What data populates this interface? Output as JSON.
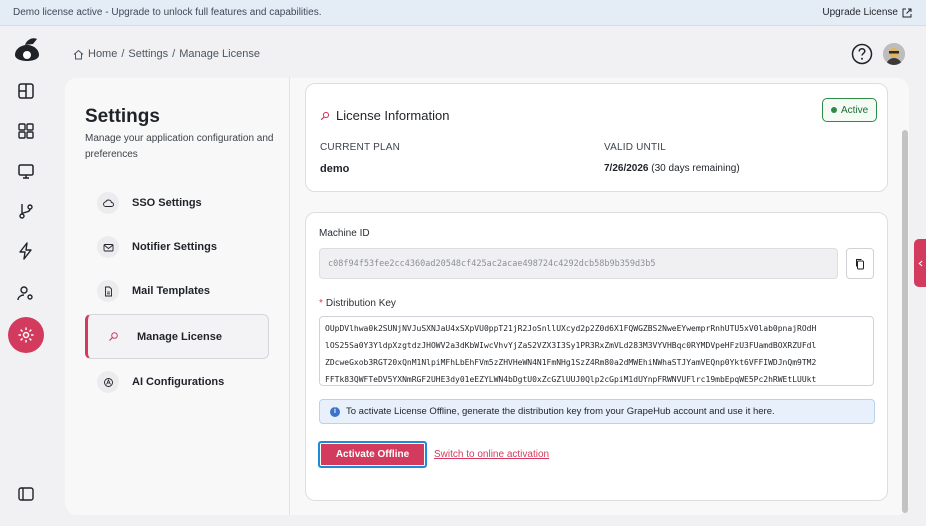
{
  "banner": {
    "message": "Demo license active - Upgrade to unlock full features and capabilities.",
    "upgrade_label": "Upgrade License"
  },
  "breadcrumb": {
    "home": "Home",
    "sep1": "/",
    "settings": "Settings",
    "sep2": "/",
    "current": "Manage License"
  },
  "settings": {
    "title": "Settings",
    "subtitle": "Manage your application configuration and preferences",
    "menu": [
      {
        "label": "SSO Settings",
        "icon": "cloud-key-icon"
      },
      {
        "label": "Notifier Settings",
        "icon": "mail-icon"
      },
      {
        "label": "Mail Templates",
        "icon": "document-icon"
      },
      {
        "label": "Manage License",
        "icon": "key-search-icon",
        "active": true
      },
      {
        "label": "AI Configurations",
        "icon": "ai-icon"
      }
    ]
  },
  "license": {
    "title": "License Information",
    "status": "Active",
    "plan_label": "CURRENT PLAN",
    "plan_value": "demo",
    "valid_label": "VALID UNTIL",
    "valid_date": "7/26/2026",
    "valid_remaining": " (30 days remaining)"
  },
  "activation": {
    "machine_id_label": "Machine ID",
    "machine_id": "c08f94f53fee2cc4360ad20548cf425ac2acae498724c4292dcb58b9b359d3b5",
    "dist_key_label": "Distribution Key",
    "dist_key_lines": [
      "OUpDVlhwa0k2SUNjNVJuSXNJaU4xSXpVU0ppT21jR2JoSnllUXcyd2p2Z0d6X1FQWGZBS2NweEYwemprRnhUTU5xV0lab0pnajROdH",
      "lOS25Sa0Y3YldpXzgtdzJHOWV2a3dKbWIwcVhvYjZaS2VZX3I3Sy1PR3RxZmVLd283M3VYVHBqc0RYMDVpeHFzU3FUamdBOXRZUFdl",
      "ZDcweGxob3RGT20xQnM1NlpiMFhLbEhFVm5zZHVHeWN4N1FmNHg1SzZ4Rm80a2dMWEhiNWhaSTJYamVEQnp0Ykt6VFFIWDJnQm9TM2",
      "FFTk83QWFTeDV5YXNmRGF2UHE3dy01eEZYLWN4bDgtU0xZcGZlUUJ0Qlp2cGpiM1dUYnpFRWNVUFlrc19mbEpqWE5Pc2hRWEtLUUkt"
    ],
    "info_text": "To activate License Offline, generate the distribution key from your GrapeHub account and use it here.",
    "activate_label": "Activate Offline",
    "switch_label": "Switch to online activation"
  },
  "colors": {
    "accent": "#d23b5d",
    "success": "#2f8a45",
    "info": "#3b73c9"
  }
}
